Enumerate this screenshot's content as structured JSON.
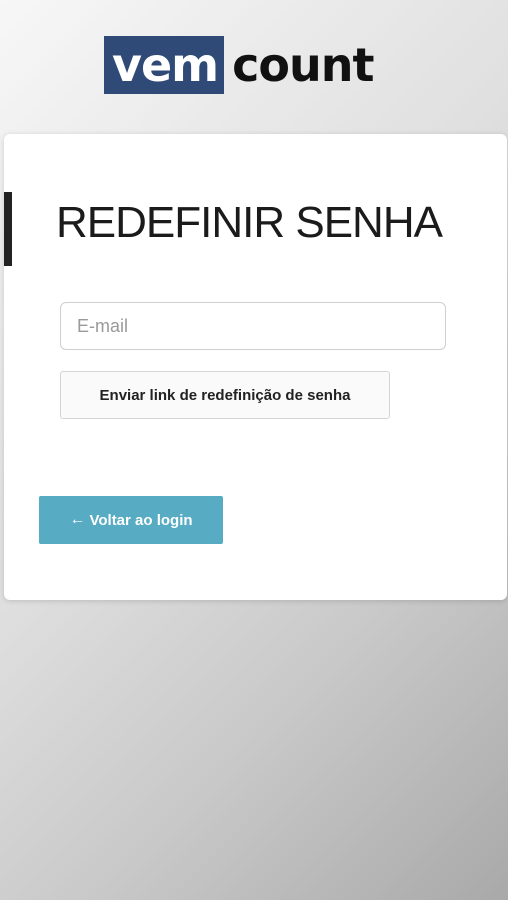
{
  "logo": {
    "part1": "vem",
    "part2": "count",
    "brand_color": "#2f4a76"
  },
  "form": {
    "title": "REDEFINIR SENHA",
    "email_placeholder": "E-mail",
    "email_value": "",
    "submit_label": "Enviar link de redefinição de senha"
  },
  "back": {
    "icon": "arrow-left-icon",
    "arrow": "←",
    "label": "Voltar ao login",
    "color": "#57acc4"
  }
}
